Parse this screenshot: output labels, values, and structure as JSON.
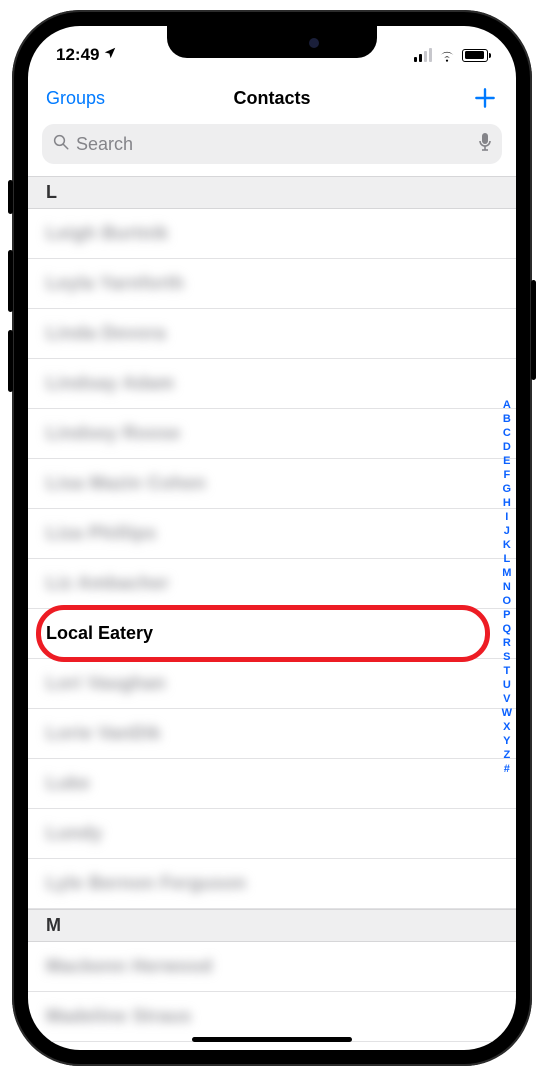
{
  "status": {
    "time": "12:49",
    "location_icon": "location-arrow"
  },
  "nav": {
    "left": "Groups",
    "title": "Contacts",
    "add_icon": "plus"
  },
  "search": {
    "placeholder": "Search",
    "left_icon": "magnifier",
    "right_icon": "microphone"
  },
  "sections": [
    {
      "letter": "L",
      "rows": [
        {
          "text": "Leigh Burtnik",
          "blurred": true,
          "highlighted": false
        },
        {
          "text": "Leyla Yarnforth",
          "blurred": true,
          "highlighted": false
        },
        {
          "text": "Linda Devora",
          "blurred": true,
          "highlighted": false
        },
        {
          "text": "Lindsay Adam",
          "blurred": true,
          "highlighted": false
        },
        {
          "text": "Lindsey Roose",
          "blurred": true,
          "highlighted": false
        },
        {
          "text": "Lisa Mazin Cohen",
          "blurred": true,
          "highlighted": false
        },
        {
          "text": "Liza Phillips",
          "blurred": true,
          "highlighted": false
        },
        {
          "text": "Liz Ambacher",
          "blurred": true,
          "highlighted": false
        },
        {
          "text": "Local Eatery",
          "blurred": false,
          "highlighted": true
        },
        {
          "text": "Lori Vaughan",
          "blurred": true,
          "highlighted": false
        },
        {
          "text": "Lorie VanDik",
          "blurred": true,
          "highlighted": false
        },
        {
          "text": "Luke",
          "blurred": true,
          "highlighted": false
        },
        {
          "text": "Lundy",
          "blurred": true,
          "highlighted": false
        },
        {
          "text": "Lyle Bernon Ferguson",
          "blurred": true,
          "highlighted": false
        }
      ]
    },
    {
      "letter": "M",
      "rows": [
        {
          "text": "Mackenn Herwood",
          "blurred": true,
          "highlighted": false
        },
        {
          "text": "Madeline Straus",
          "blurred": true,
          "highlighted": false
        }
      ]
    }
  ],
  "index_strip": [
    "A",
    "B",
    "C",
    "D",
    "E",
    "F",
    "G",
    "H",
    "I",
    "J",
    "K",
    "L",
    "M",
    "N",
    "O",
    "P",
    "Q",
    "R",
    "S",
    "T",
    "U",
    "V",
    "W",
    "X",
    "Y",
    "Z",
    "#"
  ]
}
